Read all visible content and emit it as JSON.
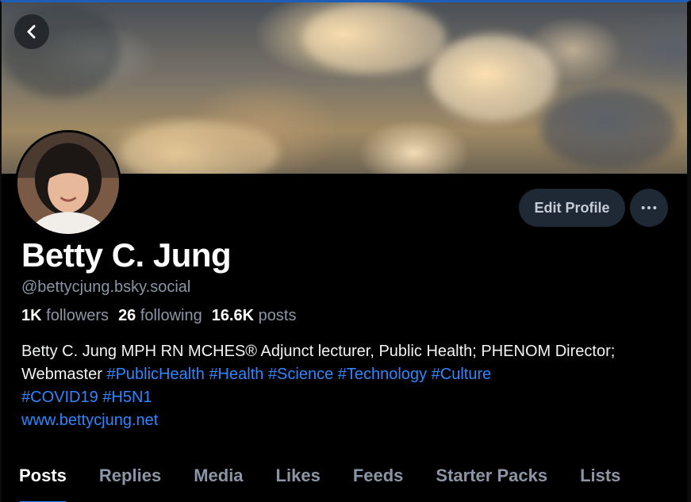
{
  "banner": {
    "back_icon": "chevron-left-icon"
  },
  "profile": {
    "avatar_alt": "profile photo",
    "display_name": "Betty C. Jung",
    "handle": "@bettycjung.bsky.social",
    "edit_label": "Edit Profile",
    "more_icon": "ellipsis-icon"
  },
  "stats": {
    "followers_count": "1K",
    "followers_label": "followers",
    "following_count": "26",
    "following_label": "following",
    "posts_count": "16.6K",
    "posts_label": "posts"
  },
  "bio": {
    "text": "Betty C. Jung MPH RN MCHES® Adjunct lecturer, Public Health; PHENOM Director; Webmaster",
    "tags": [
      "#PublicHealth",
      "#Health",
      "#Science",
      "#Technology",
      "#Culture",
      "#COVID19",
      "#H5N1"
    ],
    "link": "www.bettycjung.net"
  },
  "tabs": [
    {
      "label": "Posts",
      "active": true
    },
    {
      "label": "Replies",
      "active": false
    },
    {
      "label": "Media",
      "active": false
    },
    {
      "label": "Likes",
      "active": false
    },
    {
      "label": "Feeds",
      "active": false
    },
    {
      "label": "Starter Packs",
      "active": false
    },
    {
      "label": "Lists",
      "active": false
    }
  ],
  "colors": {
    "background": "#000000",
    "accent": "#1f7bff",
    "link": "#2f86ff",
    "muted": "#8a96a6",
    "button_bg": "#1e2935"
  }
}
